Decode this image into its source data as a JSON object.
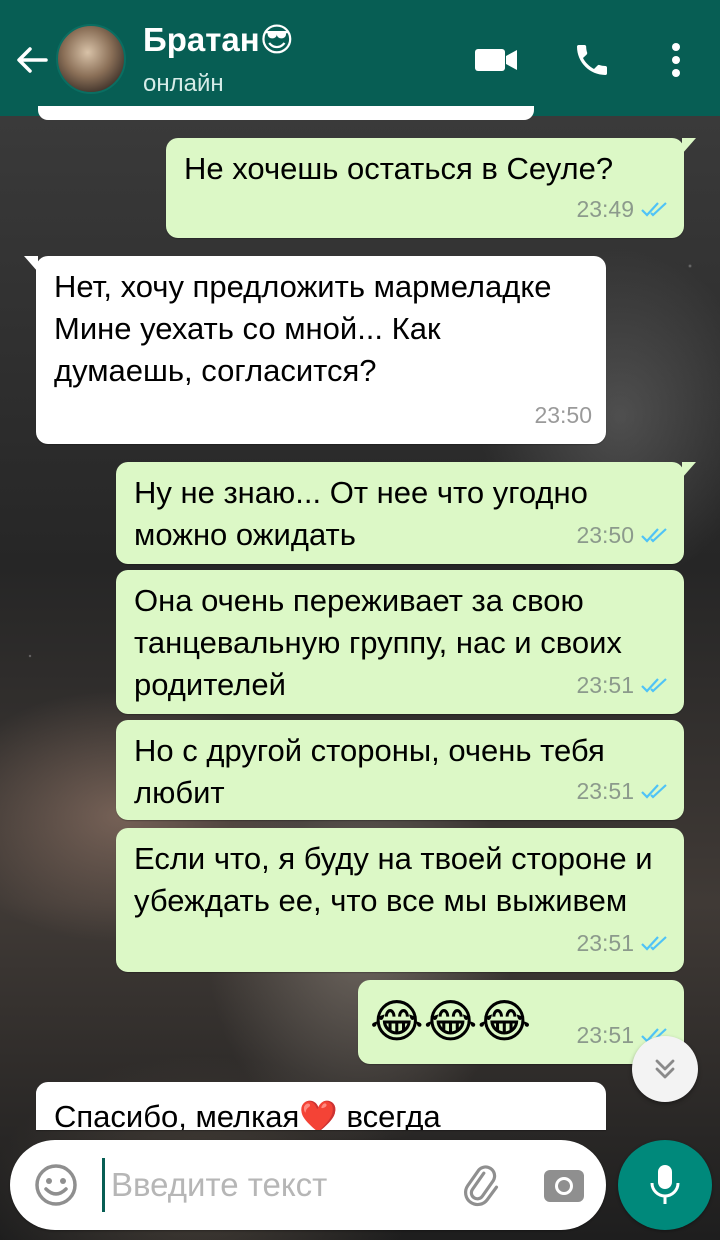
{
  "header": {
    "contact_name": "Братан😎",
    "status": "онлайн",
    "icons": [
      "back-arrow-icon",
      "video-call-icon",
      "voice-call-icon",
      "more-vert-icon"
    ]
  },
  "messages": [
    {
      "direction": "out",
      "text": "Не хочешь остаться в Сеуле?",
      "time": "23:49",
      "status": "read"
    },
    {
      "direction": "in",
      "text": "Нет, хочу предложить мармеладке Мине уехать со мной... Как думаешь, согласится?",
      "time": "23:50"
    },
    {
      "direction": "out",
      "text": "Ну не знаю... От нее что угодно можно ожидать",
      "time": "23:50",
      "status": "read"
    },
    {
      "direction": "out",
      "text": "Она очень переживает за свою танцевальную группу, нас и своих родителей",
      "time": "23:51",
      "status": "read"
    },
    {
      "direction": "out",
      "text": "Но с другой стороны, очень тебя любит",
      "time": "23:51",
      "status": "read"
    },
    {
      "direction": "out",
      "text": "Если что, я буду на твоей стороне и убеждать ее, что все мы выживем",
      "time": "23:51",
      "status": "read"
    },
    {
      "direction": "out",
      "text": "😂😂😂",
      "time": "23:51",
      "status": "read"
    },
    {
      "direction": "in",
      "text": "Спасибо, мелкая❤️ всегда",
      "time": ""
    }
  ],
  "composer": {
    "placeholder": "Введите текст",
    "value": ""
  },
  "colors": {
    "header": "#075e54",
    "outgoing_bubble": "#dcf8c6",
    "incoming_bubble": "#ffffff",
    "read_ticks": "#4fc3f7",
    "mic_button": "#00897b"
  }
}
